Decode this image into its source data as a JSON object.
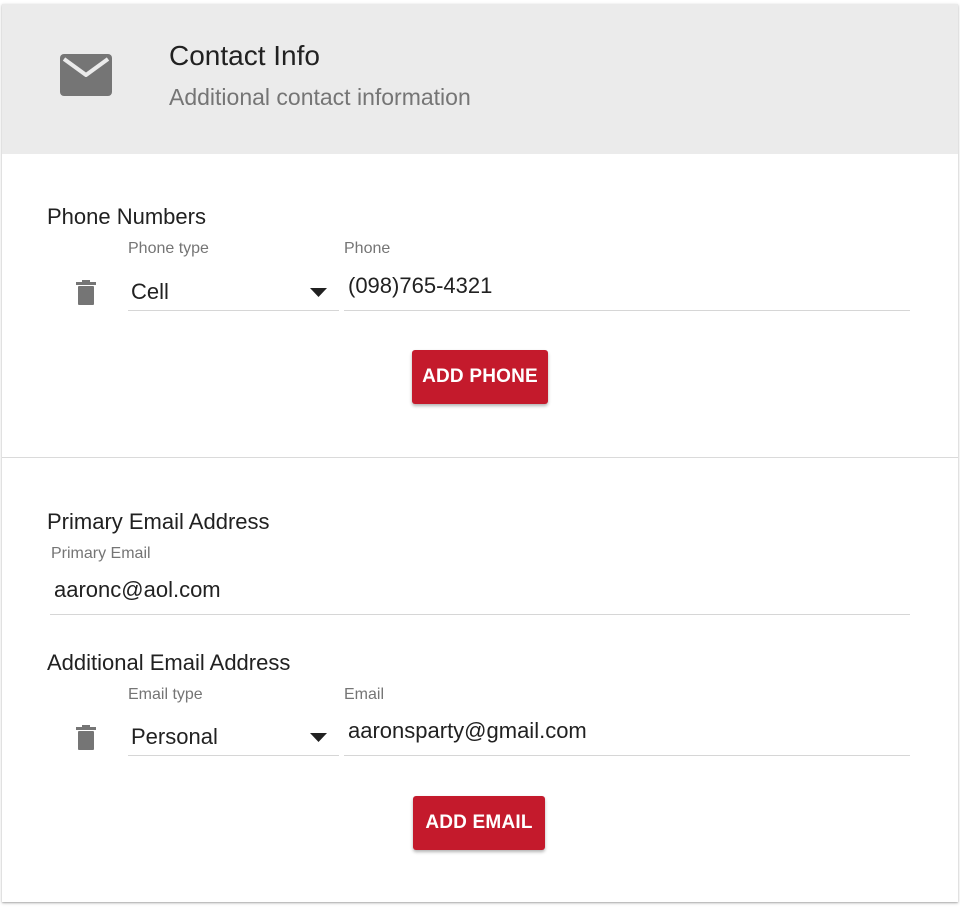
{
  "header": {
    "icon": "envelope-icon",
    "title": "Contact Info",
    "subtitle": "Additional contact information"
  },
  "phone_section": {
    "title": "Phone Numbers",
    "phone_type_label": "Phone type",
    "phone_label": "Phone",
    "phone_type_value": "Cell",
    "phone_value": "(098)765-4321",
    "delete_icon": "trash-icon",
    "add_button": "ADD PHONE"
  },
  "primary_email_section": {
    "title": "Primary Email Address",
    "label": "Primary Email",
    "value": "aaronc@aol.com"
  },
  "additional_email_section": {
    "title": "Additional Email Address",
    "email_type_label": "Email type",
    "email_label": "Email",
    "email_type_value": "Personal",
    "email_value": "aaronsparty@gmail.com",
    "delete_icon": "trash-icon",
    "add_button": "ADD EMAIL"
  },
  "colors": {
    "accent": "#c41a2c",
    "header_bg": "#ebebeb",
    "icon_gray": "#757575"
  }
}
